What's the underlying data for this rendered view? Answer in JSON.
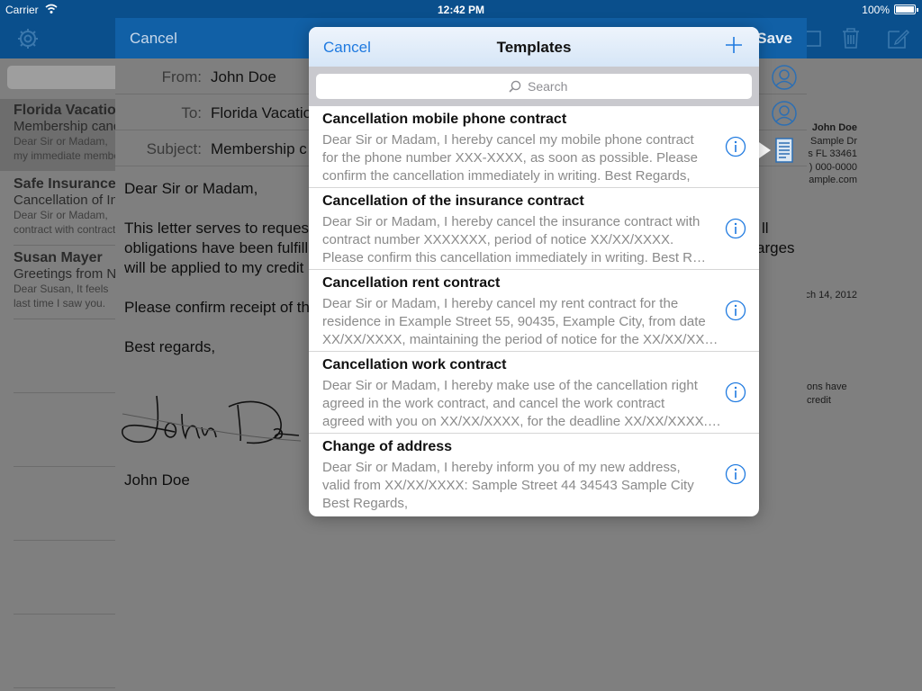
{
  "status_bar": {
    "carrier": "Carrier",
    "time": "12:42 PM",
    "battery": "100%"
  },
  "mail_list": {
    "items": [
      {
        "title": "Florida Vacation",
        "subtitle": "Membership cancellation",
        "preview": [
          "Dear Sir or Madam,",
          "my immediate membership"
        ]
      },
      {
        "title": "Safe Insurance",
        "subtitle": "Cancellation of Insurance",
        "preview": [
          "Dear Sir or Madam,",
          "contract with contract"
        ]
      },
      {
        "title": "Susan Mayer",
        "subtitle": "Greetings from N",
        "preview": [
          "Dear Susan,  It feels",
          "last time I saw you."
        ]
      }
    ]
  },
  "right_pane": {
    "address_lines": [
      "John Doe",
      "Sample Dr",
      "s FL 33461",
      ") 000-0000",
      "ample.com"
    ],
    "date": "ch 14, 2012",
    "body_lines": [
      "ons have",
      "credit"
    ]
  },
  "compose": {
    "cancel_label": "Cancel",
    "save_label": "Save",
    "from_label": "From:",
    "from_value": "John Doe",
    "to_label": "To:",
    "to_value": "Florida Vacation",
    "subject_label": "Subject:",
    "subject_value": "Membership c",
    "body": {
      "salutation": "Dear Sir or Madam,",
      "paragraph_lines": [
        "This letter serves to reques",
        "obligations have been fulfill",
        "will be applied to my credit"
      ],
      "paragraph_right": [
        "ll",
        "arges"
      ],
      "confirm": "Please confirm receipt of th",
      "closing": "Best regards,",
      "signature_name": "John Doe"
    }
  },
  "templates_popover": {
    "cancel_label": "Cancel",
    "title": "Templates",
    "search_placeholder": "Search",
    "items": [
      {
        "title": "Cancellation mobile phone contract",
        "preview": [
          "Dear Sir or Madam,  I hereby cancel my mobile phone contract",
          "for the phone number XXX-XXXX, as soon as possible.  Please",
          "confirm the cancellation immediately in writing.  Best Regards,"
        ]
      },
      {
        "title": "Cancellation of the insurance contract",
        "preview": [
          "Dear Sir or Madam,  I hereby cancel the insurance contract with",
          "contract number XXXXXXX, period of notice XX/XX/XXXX.",
          "Please confirm this cancellation immediately in writing.  Best R…"
        ]
      },
      {
        "title": "Cancellation rent contract",
        "preview": [
          "Dear Sir or Madam,  I hereby cancel my rent contract for the",
          "residence in Example Street 55, 90435, Example City, from date",
          "XX/XX/XXXX, maintaining the period of notice for the XX/XX/XX…"
        ]
      },
      {
        "title": "Cancellation work contract",
        "preview": [
          "Dear Sir or Madam,  I hereby make use of the cancellation right",
          "agreed in the work contract, and cancel the work contract",
          "agreed with you on XX/XX/XXXX, for the deadline XX/XX/XXXX.…"
        ]
      },
      {
        "title": "Change of address",
        "preview": [
          "Dear Sir or Madam,  I hereby inform you of my new address,",
          "valid from XX/XX/XXXX:  Sample Street 44 34543 Sample City",
          "Best Regards,"
        ]
      }
    ]
  },
  "colors": {
    "accent": "#1f7ae0",
    "nav_bar": "#0a4f8c",
    "compose_nav": "#1160a6",
    "preview_text": "#8a8a8a"
  }
}
